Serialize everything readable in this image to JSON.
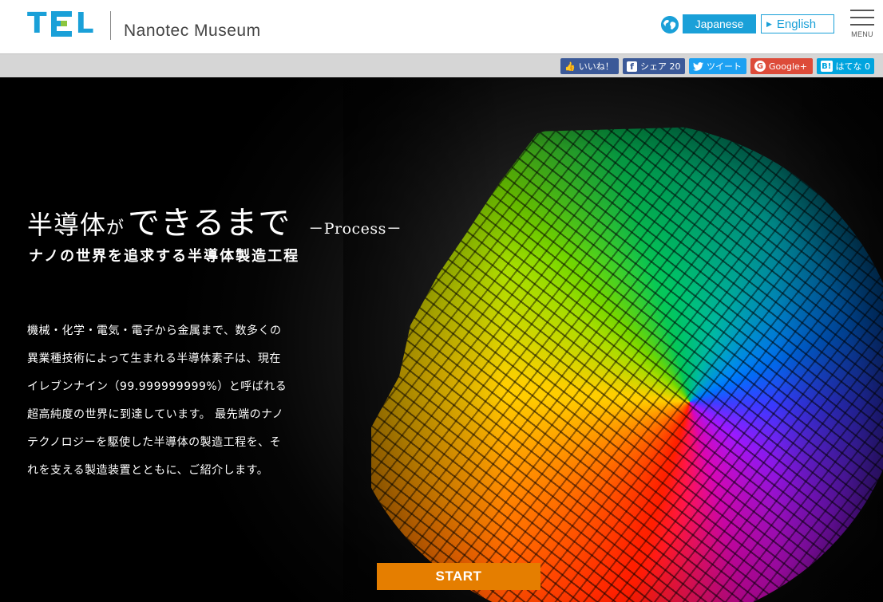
{
  "header": {
    "logo_text": "TEL",
    "site_name": "Nanotec Museum",
    "lang_japanese": "Japanese",
    "lang_english": "English",
    "menu_label": "MENU",
    "icons": {
      "globe": "globe-icon",
      "menu": "hamburger-icon",
      "english_arrow": "triangle-right-icon"
    },
    "colors": {
      "brand": "#1aa0d8",
      "logo_accent": "#8cc63f"
    }
  },
  "share": {
    "like": "いいね！",
    "facebook": "シェア 20",
    "twitter": "ツイート",
    "google": "Google+",
    "hatena": "はてな 0"
  },
  "hero": {
    "title_part1": "半導体",
    "title_part2": "が",
    "title_part3": "できるまで",
    "title_part4": "－Process－",
    "subtitle": "ナノの世界を追求する半導体製造工程",
    "description_lines": [
      "機械・化学・電気・電子から金属まで、数多くの",
      "異業種技術によって生まれる半導体素子は、現在",
      "イレブンナイン（99.999999999%）と呼ばれる",
      "超高純度の世界に到達しています。 最先端のナノ",
      "テクノロジーを駆使した半導体の製造工程を、そ",
      "れを支える製造装置とともに、ご紹介します。"
    ],
    "start_label": "START",
    "start_color": "#e57e00"
  }
}
